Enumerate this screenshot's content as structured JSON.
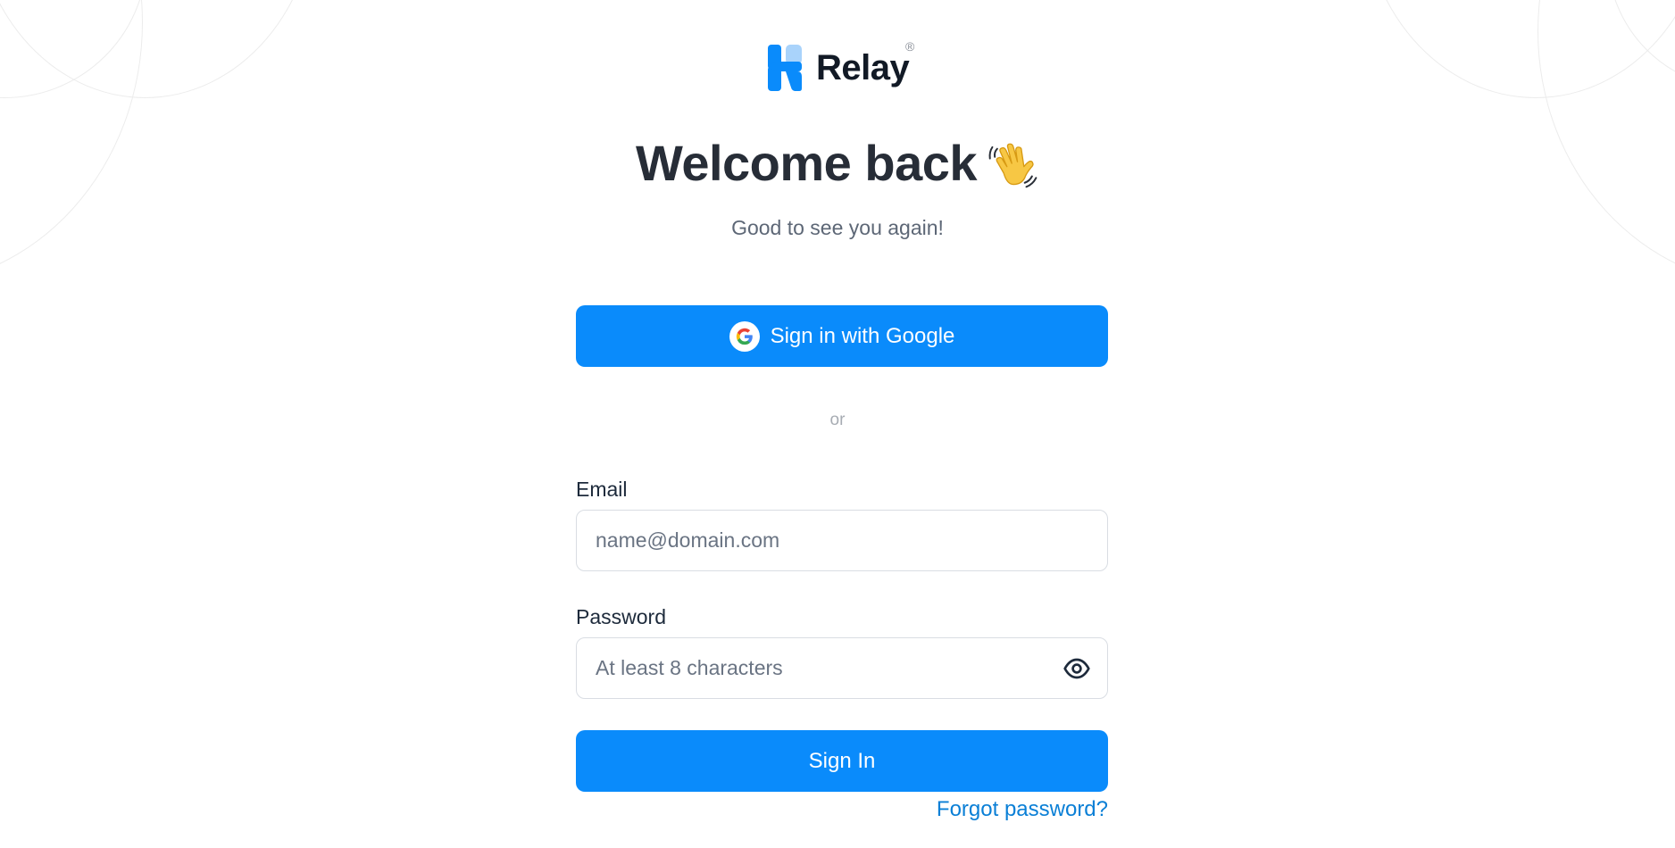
{
  "brand": {
    "name": "Relay",
    "registered_mark": "®",
    "logo_icon": "relay-logo-icon",
    "colors": {
      "primary": "#0a8bfb",
      "light": "#a9d3fb",
      "link": "#0a7fd6"
    }
  },
  "header": {
    "title": "Welcome back",
    "emoji_icon": "waving-hand-icon",
    "subtitle": "Good to see you again!"
  },
  "google_button": {
    "label": "Sign in with Google",
    "icon": "google-icon"
  },
  "divider": {
    "label": "or"
  },
  "form": {
    "email": {
      "label": "Email",
      "placeholder": "name@domain.com",
      "value": ""
    },
    "password": {
      "label": "Password",
      "placeholder": "At least 8 characters",
      "value": "",
      "toggle_icon": "eye-icon"
    },
    "submit_label": "Sign In",
    "forgot_label": "Forgot password?"
  }
}
